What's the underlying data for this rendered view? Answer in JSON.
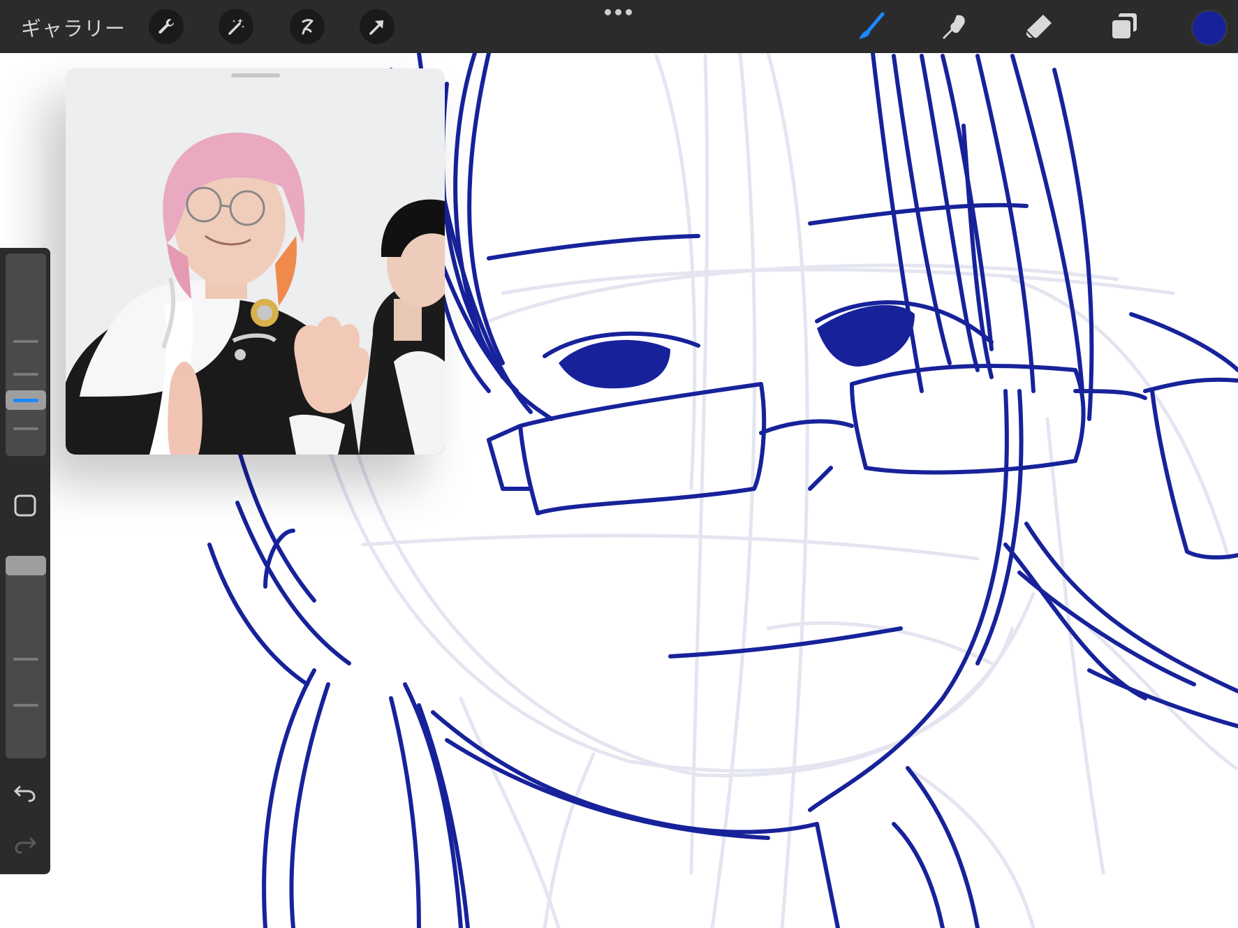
{
  "app": {
    "gallery_label": "ギャラリー"
  },
  "toolbar": {
    "left_tools": [
      "wrench-icon",
      "magic-wand-icon",
      "selection-icon",
      "transform-arrow-icon"
    ],
    "right_tools": [
      "brush-icon",
      "smudge-icon",
      "eraser-icon",
      "layers-icon"
    ],
    "active_tool": "brush-icon",
    "current_color": "#17229a"
  },
  "sidebar": {
    "brush_size_slider": "slider",
    "opacity_slider": "slider",
    "modify_button": "square-icon",
    "undo": "undo-icon",
    "redo": "redo-icon"
  },
  "reference_window": {
    "content": "photo"
  },
  "colors": {
    "ink": "#17229a",
    "sketch": "#e6e7f2",
    "accent": "#1e88ff"
  }
}
